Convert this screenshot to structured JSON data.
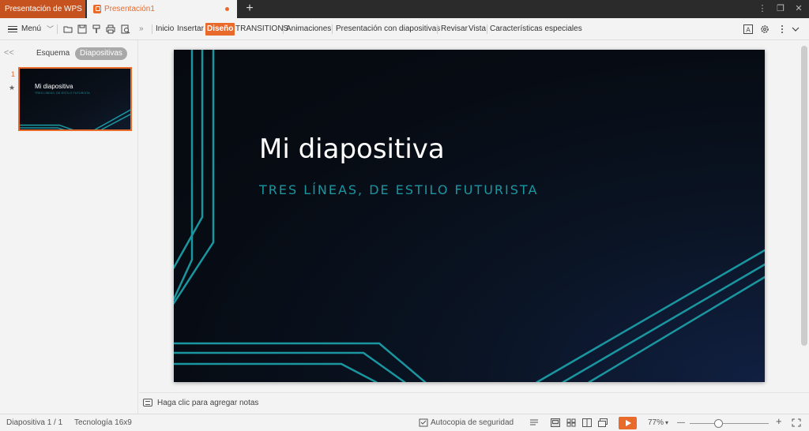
{
  "tabs": {
    "wps_tab": "Presentación de WPS",
    "doc_tab": "Presentación1",
    "new_tab": "+"
  },
  "window": {
    "menu_icon": "⋮",
    "minimize": "—",
    "restore": "❐",
    "close": "✕"
  },
  "toolbar": {
    "menu_label": "Menú",
    "menu_chevron": "﹀",
    "more": "»",
    "tool_icons": [
      "open-folder-icon",
      "save-icon",
      "format-painter-icon",
      "print-icon",
      "print-preview-icon"
    ],
    "ribbon_tabs": [
      "Inicio",
      "Insertar",
      "Diseño",
      "TRANSITIONS",
      "Animaciones",
      "Presentación con diapositivas",
      "Revisar",
      "Vista",
      "Características especiales"
    ],
    "active_tab": "Diseño",
    "right_icons": [
      "text-box-icon",
      "settings-icon",
      "more-icon",
      "collapse-ribbon-icon"
    ]
  },
  "left_panel": {
    "collapse": "<<",
    "tab_outline": "Esquema",
    "tab_slides": "Diapositivas",
    "slide_number": "1",
    "slide_star": "★"
  },
  "slide": {
    "title": "Mi diapositiva",
    "subtitle": "TRES LÍNEAS, DE ESTILO FUTURISTA",
    "thumb_title": "Mi diapositiva",
    "thumb_subtitle": "TRES LÍNEAS, DE ESTILO FUTURISTA"
  },
  "notes": {
    "placeholder": "Haga clic para agregar notas"
  },
  "status": {
    "slide_label": "Diapositiva  1 / 1",
    "theme": "Tecnología 16x9",
    "autosave": "Autocopia de seguridad",
    "zoom": "77%",
    "zoom_chevron": "▾",
    "zoom_minus": "—",
    "zoom_plus": "+",
    "zoom_level_percent": 77
  },
  "colors": {
    "accent": "#e86b2c",
    "slide_line": "#1a96a0",
    "slide_bg": "#070c14"
  }
}
